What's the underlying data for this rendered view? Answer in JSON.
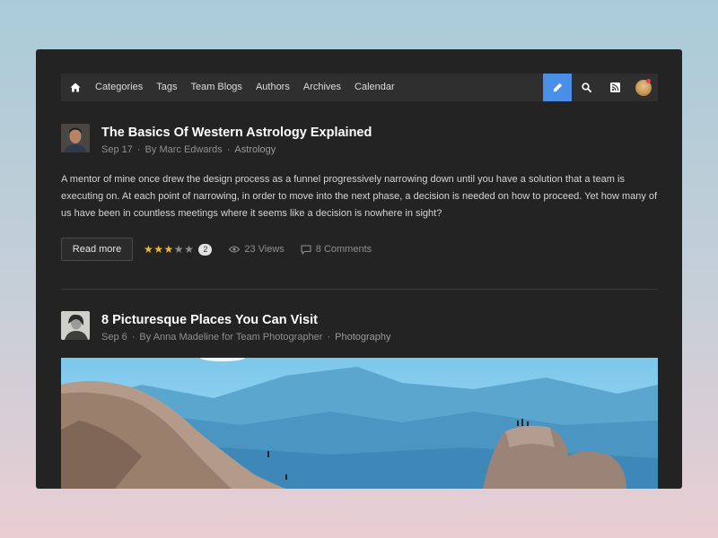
{
  "nav": {
    "items": [
      {
        "label": "Categories"
      },
      {
        "label": "Tags"
      },
      {
        "label": "Team Blogs"
      },
      {
        "label": "Authors"
      },
      {
        "label": "Archives"
      },
      {
        "label": "Calendar"
      }
    ],
    "icons": {
      "home": "home-icon",
      "compose": "pencil-icon",
      "search": "search-icon",
      "rss": "rss-icon",
      "avatar": "user-avatar"
    },
    "accent": "#4a8fe7",
    "notify_color": "#e2444b"
  },
  "posts": [
    {
      "title": "The Basics Of Western Astrology Explained",
      "date": "Sep 17",
      "byline": "By Marc Edwards",
      "category": "Astrology",
      "excerpt": "A mentor of mine once drew the design process as a funnel progressively narrowing down until you have a solution that a team is executing on. At each point of narrowing, in order to move into the next phase, a decision is needed on how to proceed. Yet how many of us have been in countless meetings where it seems like a decision is nowhere in sight?",
      "read_more": "Read more",
      "rating": 3,
      "rating_max": 5,
      "rating_count": "2",
      "views": "23 Views",
      "comments": "8 Comments"
    },
    {
      "title": "8 Picturesque Places You Can Visit",
      "date": "Sep 6",
      "byline": "By Anna Madeline for Team Photographer",
      "category": "Photography"
    }
  ]
}
